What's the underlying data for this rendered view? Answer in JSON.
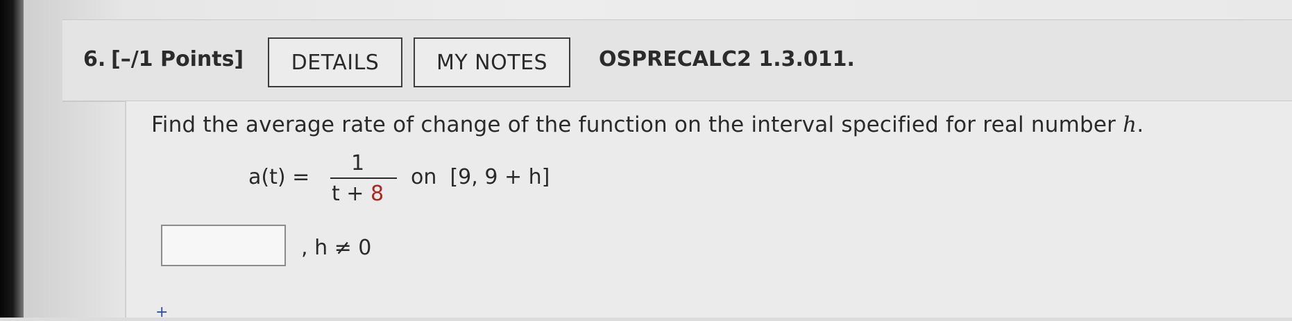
{
  "question": {
    "number": "6.",
    "points": "[–/1 Points]",
    "details_label": "DETAILS",
    "my_notes_label": "MY NOTES",
    "code": "OSPRECALC2 1.3.011.",
    "prompt": "Find the average rate of change of the function on the interval specified for real number",
    "prompt_var": "h",
    "prompt_end": "."
  },
  "function": {
    "lhs": "a(t) =",
    "numerator": "1",
    "denominator_var": "t +",
    "denominator_num": "8",
    "on_label": "on",
    "interval": "[9, 9 + h]"
  },
  "answer": {
    "value": "",
    "condition": ", h ≠ 0"
  },
  "footer": {
    "plus_glyph": "+"
  },
  "colors": {
    "highlight_number": "#b0261c",
    "link_blue": "#2e4fb2"
  }
}
